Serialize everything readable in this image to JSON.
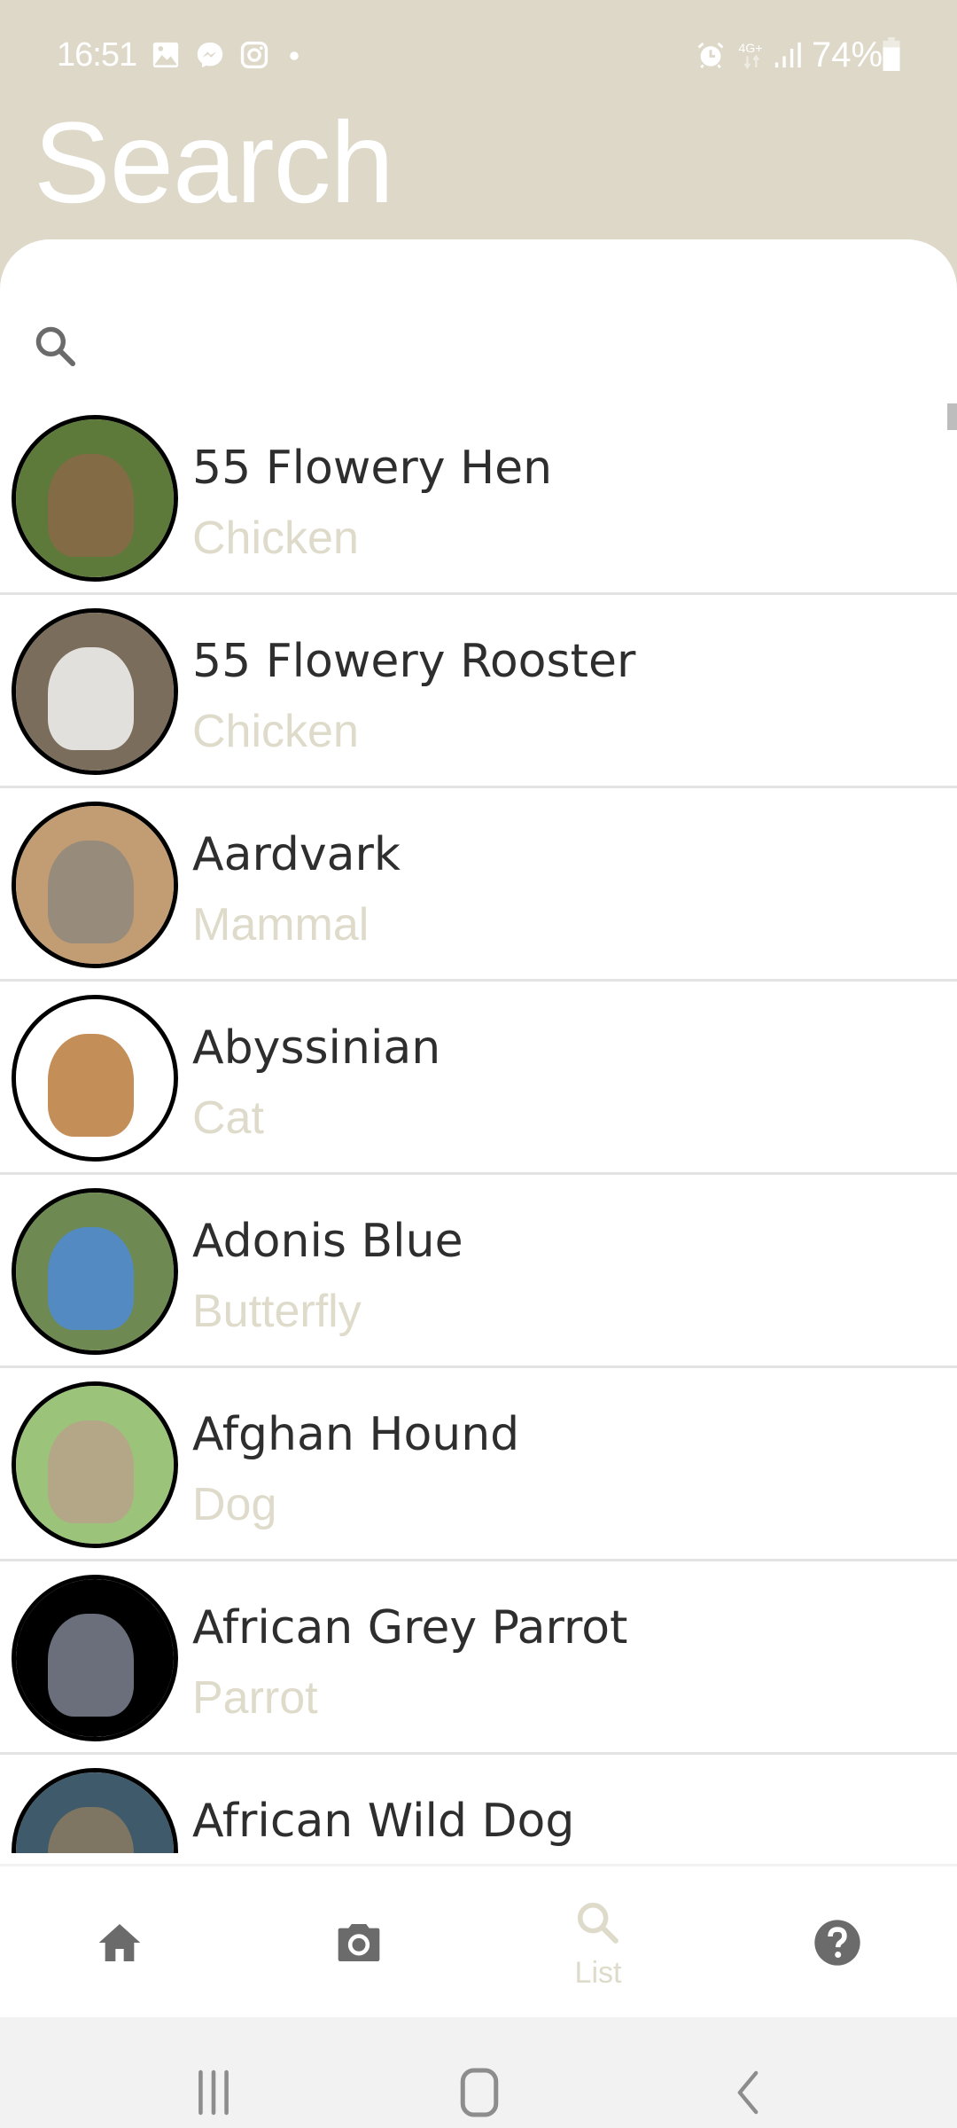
{
  "status_bar": {
    "time": "16:51",
    "left_icons": [
      "gallery-icon",
      "messenger-icon",
      "instagram-icon",
      "dot-icon"
    ],
    "right_icons": [
      "alarm-icon",
      "4g-plus-icon",
      "signal-icon",
      "battery-icon"
    ],
    "network_label": "4G+",
    "battery_percent": "74%"
  },
  "header": {
    "title": "Search"
  },
  "search": {
    "value": "",
    "placeholder": ""
  },
  "list": {
    "items": [
      {
        "name": "55 Flowery Hen",
        "type": "Chicken",
        "image": "hen-photo",
        "bg": "#5d7a3a",
        "subject": "#8a6a48"
      },
      {
        "name": "55 Flowery Rooster",
        "type": "Chicken",
        "image": "rooster-photo",
        "bg": "#7a6d5c",
        "subject": "#f4f4f2"
      },
      {
        "name": "Aardvark",
        "type": "Mammal",
        "image": "aardvark-photo",
        "bg": "#c29c72",
        "subject": "#8f887c"
      },
      {
        "name": "Abyssinian",
        "type": "Cat",
        "image": "abyssinian-cat-photo",
        "bg": "#ffffff",
        "subject": "#b97a3a"
      },
      {
        "name": "Adonis Blue",
        "type": "Butterfly",
        "image": "adonis-blue-butterfly-photo",
        "bg": "#6e8a52",
        "subject": "#4f89d6"
      },
      {
        "name": "Afghan Hound",
        "type": "Dog",
        "image": "afghan-hound-photo",
        "bg": "#9bc37a",
        "subject": "#b8a28a"
      },
      {
        "name": "African Grey Parrot",
        "type": "Parrot",
        "image": "african-grey-parrot-photo",
        "bg": "#000000",
        "subject": "#7d8290"
      },
      {
        "name": "African Wild Dog",
        "type": "",
        "image": "african-wild-dog-photo",
        "bg": "#3f5a6a",
        "subject": "#8a7a60"
      }
    ]
  },
  "bottom_nav": {
    "tabs": [
      {
        "id": "home",
        "icon": "home-icon",
        "label": "",
        "active": false
      },
      {
        "id": "camera",
        "icon": "camera-icon",
        "label": "",
        "active": false
      },
      {
        "id": "list",
        "icon": "search-icon",
        "label": "List",
        "active": true
      },
      {
        "id": "help",
        "icon": "help-icon",
        "label": "",
        "active": false
      }
    ]
  },
  "system_nav": {
    "buttons": [
      "recent-apps",
      "home",
      "back"
    ]
  },
  "colors": {
    "header_bg": "#ddd8c8",
    "accent": "#dedbcb",
    "text_primary": "#2e2e2e",
    "icon_gray": "#6b6b6b",
    "divider": "#e3e3e3",
    "system_nav_bg": "#f2f2f2"
  }
}
